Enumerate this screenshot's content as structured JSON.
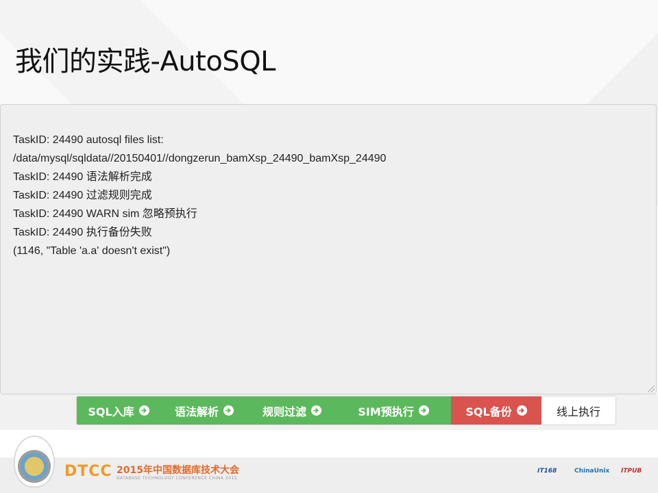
{
  "slide": {
    "title": "我们的实践-AutoSQL"
  },
  "log": {
    "lines": [
      "TaskID: 24490 autosql files list:",
      "/data/mysql/sqldata//20150401//dongzerun_bamXsp_24490_bamXsp_24490",
      "TaskID: 24490 语法解析完成",
      "TaskID: 24490 过滤规则完成",
      "TaskID: 24490 WARN sim 忽略预执行",
      "TaskID: 24490 执行备份失败",
      "(1146, \"Table 'a.a' doesn't exist\")"
    ]
  },
  "steps": [
    {
      "label": "SQL入库",
      "status": "done",
      "icon": "arrow-circle-right-icon"
    },
    {
      "label": "语法解析",
      "status": "done",
      "icon": "arrow-circle-right-icon"
    },
    {
      "label": "规则过滤",
      "status": "done",
      "icon": "arrow-circle-right-icon"
    },
    {
      "label": "SIM预执行",
      "status": "done",
      "icon": "arrow-circle-right-icon"
    },
    {
      "label": "SQL备份",
      "status": "failed",
      "icon": "arrow-circle-right-icon"
    },
    {
      "label": "线上执行",
      "status": "pending"
    }
  ],
  "colors": {
    "done": "#5cb85c",
    "failed": "#d9534f",
    "pending": "#ffffff"
  },
  "footer": {
    "logo_text": "DTCC",
    "conference_name": "2015年中国数据库技术大会",
    "conference_subtitle": "DATABASE TECHNOLOGY CONFERENCE CHINA 2015",
    "sponsors": [
      "IT168",
      "ChinaUnix",
      "ITPUB"
    ]
  }
}
